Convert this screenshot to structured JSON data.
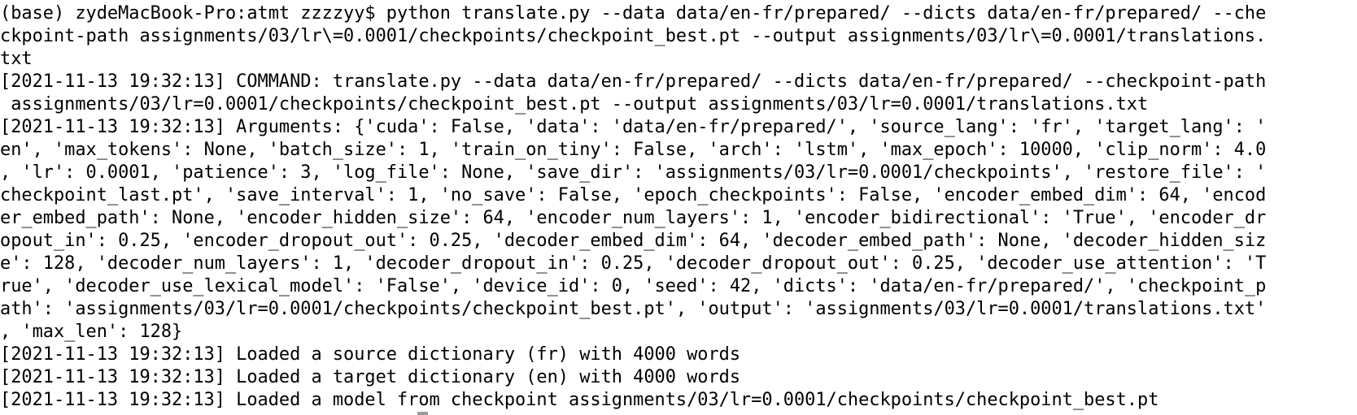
{
  "terminal": {
    "lines": [
      "(base) zydeMacBook-Pro:atmt zzzzyy$ python translate.py --data data/en-fr/prepared/ --dicts data/en-fr/prepared/ --che",
      "ckpoint-path assignments/03/lr\\=0.0001/checkpoints/checkpoint_best.pt --output assignments/03/lr\\=0.0001/translations.",
      "txt",
      "[2021-11-13 19:32:13] COMMAND: translate.py --data data/en-fr/prepared/ --dicts data/en-fr/prepared/ --checkpoint-path",
      " assignments/03/lr=0.0001/checkpoints/checkpoint_best.pt --output assignments/03/lr=0.0001/translations.txt",
      "[2021-11-13 19:32:13] Arguments: {'cuda': False, 'data': 'data/en-fr/prepared/', 'source_lang': 'fr', 'target_lang': '",
      "en', 'max_tokens': None, 'batch_size': 1, 'train_on_tiny': False, 'arch': 'lstm', 'max_epoch': 10000, 'clip_norm': 4.0",
      ", 'lr': 0.0001, 'patience': 3, 'log_file': None, 'save_dir': 'assignments/03/lr=0.0001/checkpoints', 'restore_file': '",
      "checkpoint_last.pt', 'save_interval': 1, 'no_save': False, 'epoch_checkpoints': False, 'encoder_embed_dim': 64, 'encod",
      "er_embed_path': None, 'encoder_hidden_size': 64, 'encoder_num_layers': 1, 'encoder_bidirectional': 'True', 'encoder_dr",
      "opout_in': 0.25, 'encoder_dropout_out': 0.25, 'decoder_embed_dim': 64, 'decoder_embed_path': None, 'decoder_hidden_siz",
      "e': 128, 'decoder_num_layers': 1, 'decoder_dropout_in': 0.25, 'decoder_dropout_out': 0.25, 'decoder_use_attention': 'T",
      "rue', 'decoder_use_lexical_model': 'False', 'device_id': 0, 'seed': 42, 'dicts': 'data/en-fr/prepared/', 'checkpoint_p",
      "ath': 'assignments/03/lr=0.0001/checkpoints/checkpoint_best.pt', 'output': 'assignments/03/lr=0.0001/translations.txt'",
      ", 'max_len': 128}",
      "[2021-11-13 19:32:13] Loaded a source dictionary (fr) with 4000 words",
      "[2021-11-13 19:32:13] Loaded a target dictionary (en) with 4000 words",
      "[2021-11-13 19:32:13] Loaded a model from checkpoint assignments/03/lr=0.0001/checkpoints/checkpoint_best.pt"
    ]
  }
}
